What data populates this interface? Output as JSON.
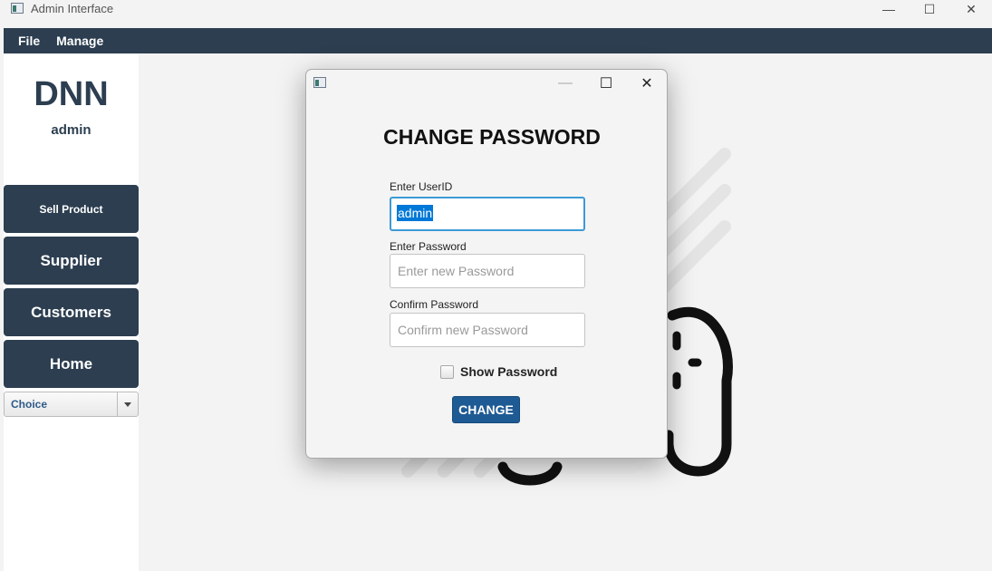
{
  "window": {
    "title": "Admin Interface",
    "controls": {
      "minimize": "—",
      "maximize": "☐",
      "close": "✕"
    }
  },
  "menubar": {
    "items": [
      "File",
      "Manage"
    ]
  },
  "sidebar": {
    "brand": "DNN",
    "role": "admin",
    "buttons": [
      "Sell Product",
      "Supplier",
      "Customers",
      "Home"
    ],
    "choice": {
      "label": "Choice"
    }
  },
  "dialog": {
    "controls": {
      "minimize": "—",
      "maximize": "☐",
      "close": "✕"
    },
    "title": "CHANGE PASSWORD",
    "userid": {
      "label": "Enter UserID",
      "value": "admin"
    },
    "password": {
      "label": "Enter Password",
      "placeholder": "Enter new Password"
    },
    "confirm": {
      "label": "Confirm Password",
      "placeholder": "Confirm new Password"
    },
    "show_password": {
      "label": "Show Password",
      "checked": false
    },
    "submit_label": "CHANGE"
  },
  "colors": {
    "primary": "#2c3e50",
    "accent": "#1e5a94",
    "focus": "#3c9ad6",
    "selection": "#0078d7"
  },
  "icons": [
    "app-window-icon",
    "minimize-icon",
    "maximize-icon",
    "close-icon",
    "chevron-down-icon"
  ]
}
